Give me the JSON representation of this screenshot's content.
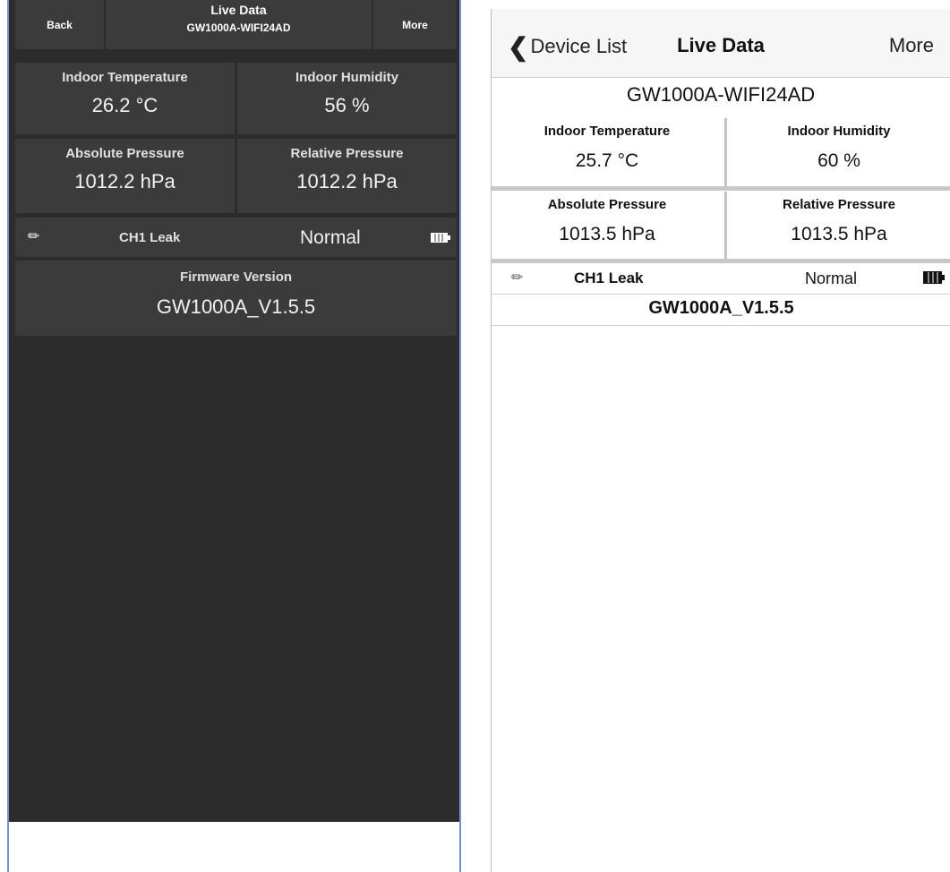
{
  "android": {
    "back_label": "Back",
    "title": "Live Data",
    "device_name": "GW1000A-WIFI24AD",
    "more_label": "More",
    "indoor_temperature": {
      "label": "Indoor Temperature",
      "value": "26.2 °C"
    },
    "indoor_humidity": {
      "label": "Indoor Humidity",
      "value": "56 %"
    },
    "absolute_pressure": {
      "label": "Absolute Pressure",
      "value": "1012.2 hPa"
    },
    "relative_pressure": {
      "label": "Relative Pressure",
      "value": "1012.2 hPa"
    },
    "leak": {
      "name": "CH1 Leak",
      "status": "Normal",
      "edit_icon": "pencil-icon",
      "battery_icon": "battery-icon"
    },
    "firmware": {
      "label": "Firmware Version",
      "value": "GW1000A_V1.5.5"
    }
  },
  "ios": {
    "back_label": "Device List",
    "back_icon": "chevron-left-icon",
    "title": "Live Data",
    "more_label": "More",
    "device_name": "GW1000A-WIFI24AD",
    "indoor_temperature": {
      "label": "Indoor Temperature",
      "value": "25.7 °C"
    },
    "indoor_humidity": {
      "label": "Indoor Humidity",
      "value": "60 %"
    },
    "absolute_pressure": {
      "label": "Absolute Pressure",
      "value": "1013.5 hPa"
    },
    "relative_pressure": {
      "label": "Relative Pressure",
      "value": "1013.5 hPa"
    },
    "leak": {
      "name": "CH1 Leak",
      "status": "Normal",
      "edit_icon": "pencil-icon",
      "battery_icon": "battery-icon"
    },
    "firmware": {
      "value": "GW1000A_V1.5.5"
    }
  },
  "colors": {
    "android_background": "#2c2c2c",
    "android_cell": "#3b3b3b",
    "phone_frame": "#6d95c6",
    "ios_nav": "#f6f6f6",
    "ios_separator": "#c4c4c4"
  }
}
